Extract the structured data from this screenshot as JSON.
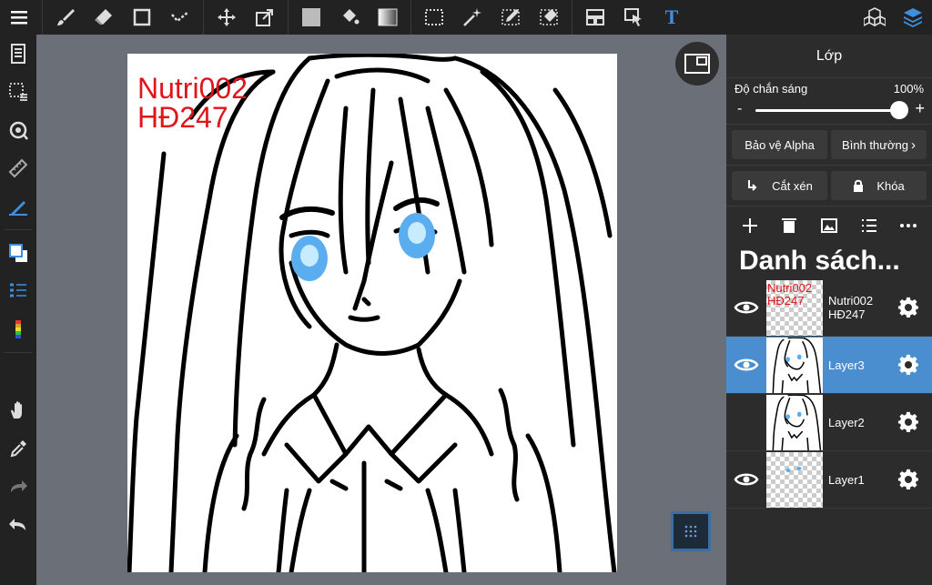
{
  "toolbar": {
    "icons": [
      "menu-icon",
      "brush-icon",
      "eraser-icon",
      "shape-icon",
      "correction-icon",
      "move-icon",
      "transform-icon",
      "fill-color-icon",
      "bucket-icon",
      "gradient-icon",
      "select-rect-icon",
      "magic-wand-icon",
      "select-pen-icon",
      "select-eraser-icon",
      "frame-icon",
      "select-layer-icon",
      "text-icon",
      "material-icon",
      "layers-icon"
    ],
    "text_tool_label": "T"
  },
  "canvas": {
    "text_line1": "Nutri002",
    "text_line2": "HĐ247"
  },
  "panel": {
    "title": "Lớp",
    "opacity_label": "Độ chắn sáng",
    "opacity_value": "100%",
    "opacity_fraction": 1.0,
    "minus": "-",
    "plus": "+",
    "alpha_protect": "Bảo vệ Alpha",
    "blend_mode": "Bình thường",
    "clipping": "Cắt xén",
    "lock": "Khóa",
    "list_title": "Danh sách...",
    "layers": [
      {
        "name_line1": "Nutri002",
        "name_line2": "HĐ247",
        "thumb_line1": "Nutri002",
        "thumb_line2": "HĐ247",
        "visible": true,
        "selected": false
      },
      {
        "name_line1": "Layer3",
        "name_line2": "",
        "visible": true,
        "selected": true
      },
      {
        "name_line1": "Layer2",
        "name_line2": "",
        "visible": false,
        "selected": false
      },
      {
        "name_line1": "Layer1",
        "name_line2": "",
        "visible": true,
        "selected": false
      }
    ]
  },
  "colors": {
    "accent": "#4a8ed0",
    "text_red": "#e0151a",
    "canvas_bg": "#6b7078",
    "panel_bg": "#2c2c2c"
  }
}
